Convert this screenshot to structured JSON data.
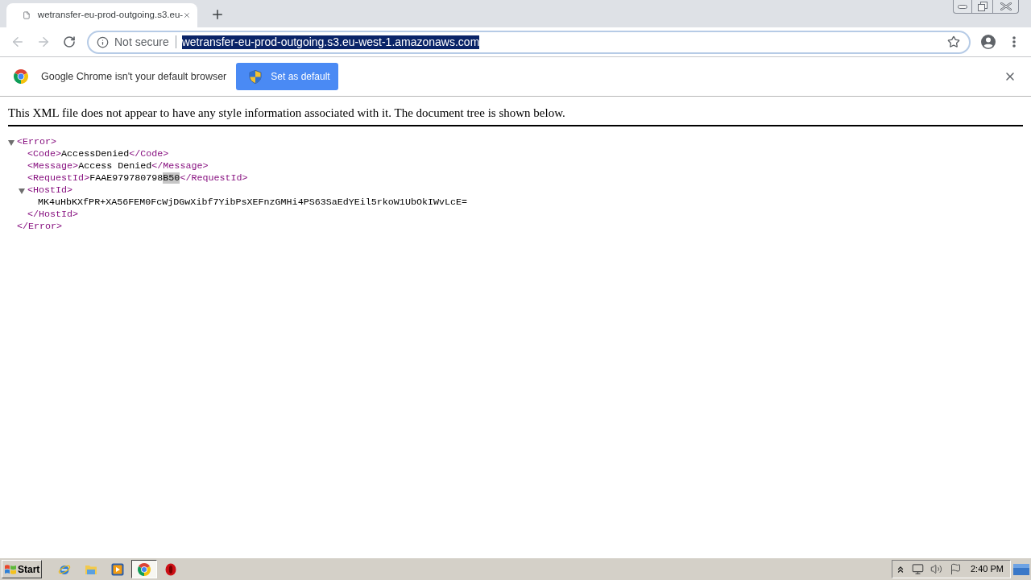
{
  "window": {
    "tabs": [
      {
        "title": "wetransfer-eu-prod-outgoing.s3.eu-",
        "selected": true
      }
    ]
  },
  "toolbar": {
    "back_disabled": true,
    "forward_disabled": true,
    "security_label": "Not secure",
    "url": "wetransfer-eu-prod-outgoing.s3.eu-west-1.amazonaws.com",
    "url_selected": true
  },
  "infobar": {
    "message": "Google Chrome isn't your default browser",
    "button": "Set as default"
  },
  "page": {
    "notice": "This XML file does not appear to have any style information associated with it. The document tree is shown below.",
    "tree": [
      {
        "kind": "element",
        "open": "<Error>",
        "close": "</Error>",
        "expanded": true,
        "children": [
          {
            "kind": "leaf",
            "open": "<Code>",
            "close": "</Code>",
            "value": [
              {
                "text": "AccessDenied",
                "highlighted": false
              }
            ]
          },
          {
            "kind": "leaf",
            "open": "<Message>",
            "close": "</Message>",
            "value": [
              {
                "text": "Access Denied",
                "highlighted": false
              }
            ]
          },
          {
            "kind": "leaf",
            "open": "<RequestId>",
            "close": "</RequestId>",
            "value": [
              {
                "text": "FAAE979780798",
                "highlighted": false
              },
              {
                "text": "B50",
                "highlighted": true
              }
            ]
          },
          {
            "kind": "element",
            "open": "<HostId>",
            "close": "</HostId>",
            "expanded": true,
            "children": [
              {
                "kind": "text",
                "text": "MK4uHbKXfPR+XA56FEM0FcWjDGwXibf7YibPsXEFnzGMHi4PS63SaEdYEil5rkoW1UbOkIWvLcE="
              }
            ]
          }
        ]
      }
    ]
  },
  "taskbar": {
    "start": "Start",
    "apps": [
      {
        "kind": "ie",
        "selected": false
      },
      {
        "kind": "explorer",
        "selected": false
      },
      {
        "kind": "media",
        "selected": false
      },
      {
        "kind": "chrome",
        "selected": true
      },
      {
        "kind": "opera",
        "selected": false
      }
    ],
    "clock": "2:40 PM"
  }
}
